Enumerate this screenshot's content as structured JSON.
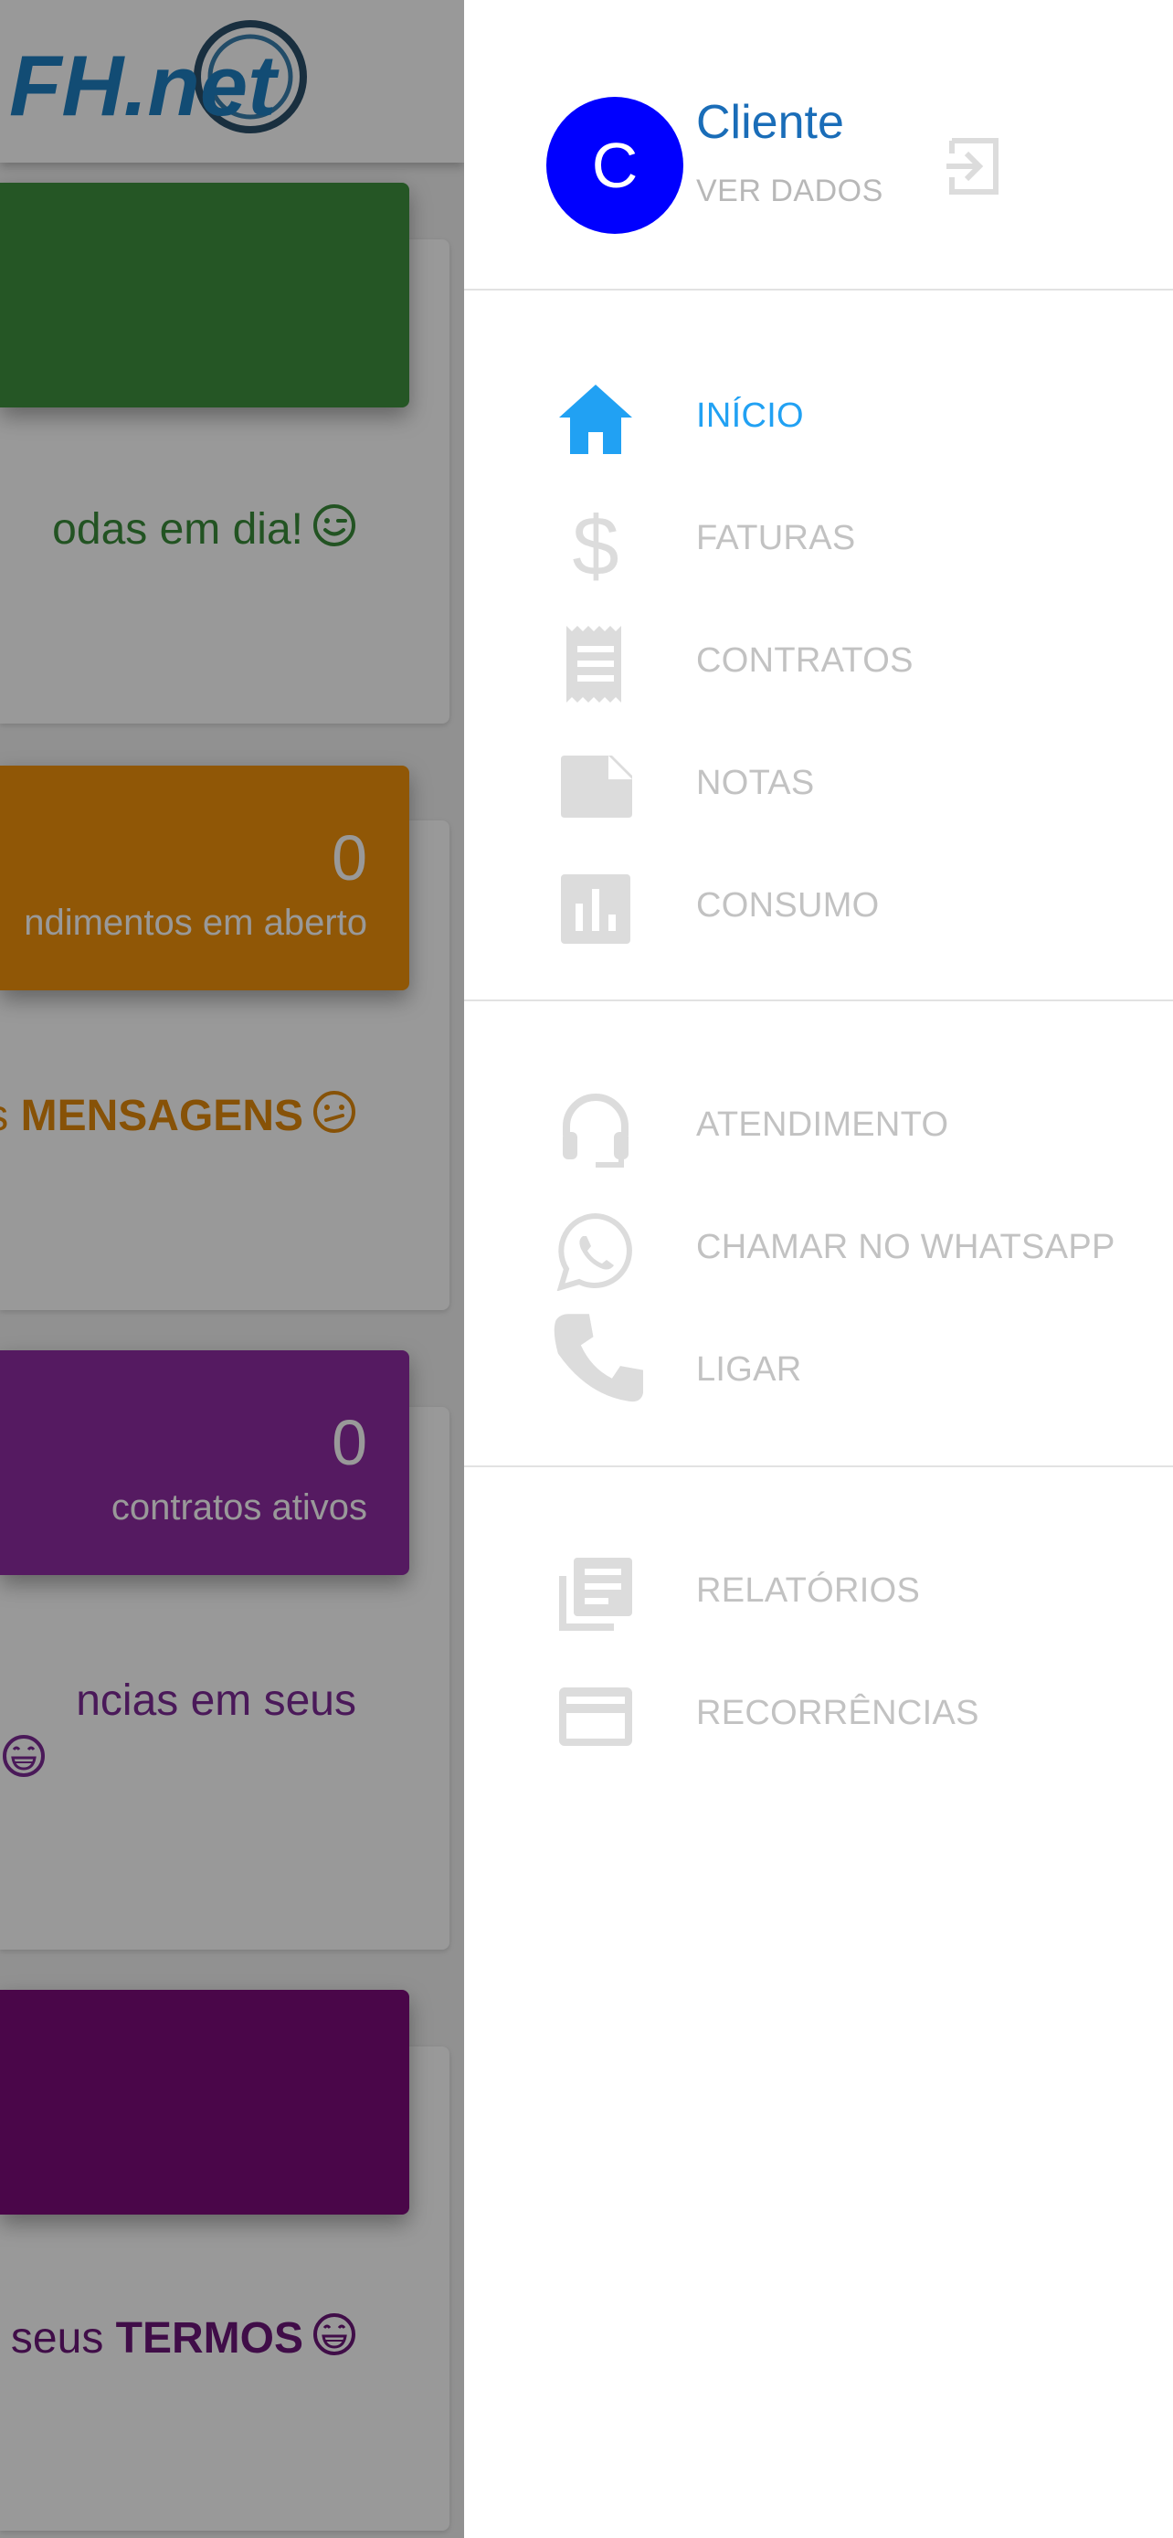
{
  "background": {
    "logo_text": "FH.net",
    "cards": [
      {
        "color": "#3f8f3e",
        "text_plain": "odas em dia!",
        "text_bold": "",
        "count": "",
        "count_label": "",
        "text_color": "#3a8b39"
      },
      {
        "color": "#f1920a",
        "text_plain": "s ",
        "text_bold": "MENSAGENS",
        "count": "0",
        "count_label": "ndimentos em aberto",
        "text_color": "#e1890c"
      },
      {
        "color": "#8e2ca2",
        "text_plain_line1": "ncias em seus",
        "count": "0",
        "count_label": "contratos ativos",
        "text_color": "#7c2a94"
      },
      {
        "color": "#7c0a7a",
        "text_plain": "em seus ",
        "text_bold": "TERMOS",
        "text_color": "#6b1778"
      }
    ]
  },
  "drawer": {
    "user": {
      "avatar_letter": "C",
      "name": "Cliente",
      "view_label": "VER DADOS"
    },
    "menu_primary": [
      {
        "label": "INÍCIO",
        "icon": "home-icon",
        "active": true
      },
      {
        "label": "FATURAS",
        "icon": "dollar-icon",
        "active": false
      },
      {
        "label": "CONTRATOS",
        "icon": "receipt-icon",
        "active": false
      },
      {
        "label": "NOTAS",
        "icon": "note-icon",
        "active": false
      },
      {
        "label": "CONSUMO",
        "icon": "bar-chart-icon",
        "active": false
      }
    ],
    "menu_contact": [
      {
        "label": "ATENDIMENTO",
        "icon": "headset-icon"
      },
      {
        "label": "CHAMAR NO WHATSAPP",
        "icon": "whatsapp-icon"
      },
      {
        "label": "LIGAR",
        "icon": "phone-icon"
      }
    ],
    "menu_extra": [
      {
        "label": "RELATÓRIOS",
        "icon": "library-books-icon"
      },
      {
        "label": "RECORRÊNCIAS",
        "icon": "credit-card-icon"
      }
    ]
  },
  "colors": {
    "accent": "#21a1f3",
    "avatar": "#0000ff",
    "inactive_icon": "#dcdcdc",
    "inactive_text": "#c2c2c2"
  }
}
